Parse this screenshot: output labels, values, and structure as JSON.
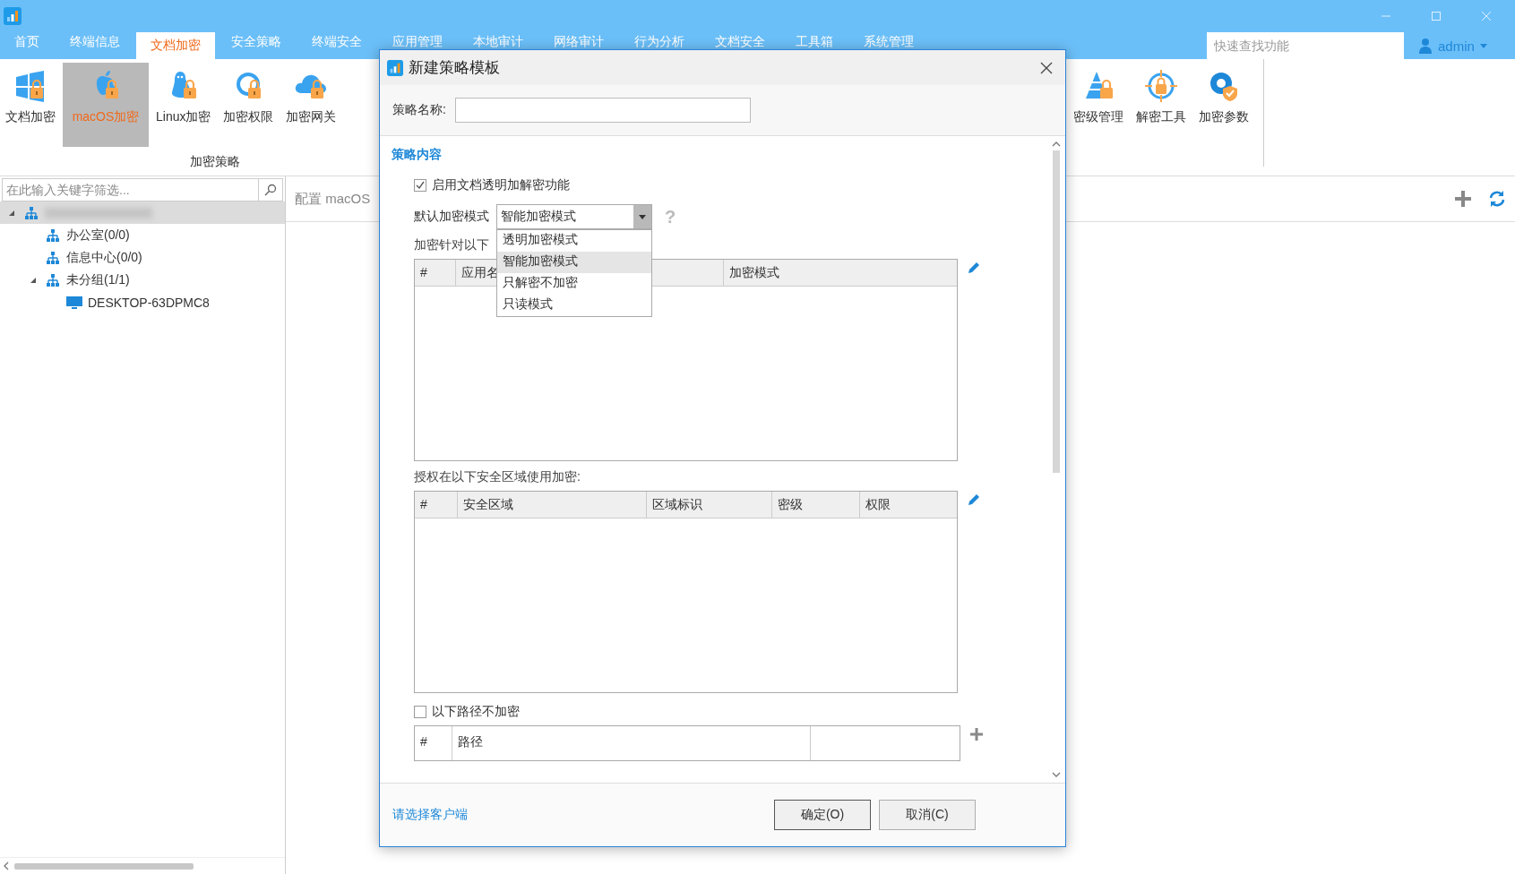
{
  "menu": [
    {
      "label": "首页",
      "selected": false
    },
    {
      "label": "终端信息",
      "selected": false
    },
    {
      "label": "文档加密",
      "selected": true
    },
    {
      "label": "安全策略",
      "selected": false
    },
    {
      "label": "终端安全",
      "selected": false
    },
    {
      "label": "应用管理",
      "selected": false
    },
    {
      "label": "本地审计",
      "selected": false
    },
    {
      "label": "网络审计",
      "selected": false
    },
    {
      "label": "行为分析",
      "selected": false
    },
    {
      "label": "文档安全",
      "selected": false
    },
    {
      "label": "工具箱",
      "selected": false
    },
    {
      "label": "系统管理",
      "selected": false
    }
  ],
  "search": {
    "placeholder": "快速查找功能"
  },
  "user": {
    "name": "admin"
  },
  "ribbon": {
    "group": {
      "label": "加密策略",
      "items": [
        {
          "label": "文档加密",
          "kind": "windows",
          "selected": false
        },
        {
          "label": "macOS加密",
          "kind": "apple",
          "selected": true
        },
        {
          "label": "Linux加密",
          "kind": "linux",
          "selected": false
        },
        {
          "label": "加密权限",
          "kind": "gear",
          "selected": false
        },
        {
          "label": "加密网关",
          "kind": "cloud",
          "selected": false
        }
      ]
    },
    "right_items": [
      {
        "label": "密级管理",
        "kind": "pyramid",
        "selected": false
      },
      {
        "label": "解密工具",
        "kind": "target",
        "selected": false
      },
      {
        "label": "加密参数",
        "kind": "params",
        "selected": false
      }
    ]
  },
  "sidebar": {
    "filter_placeholder": "在此输入关键字筛选...",
    "tree": [
      {
        "kind": "group",
        "expanded": true,
        "selected": true,
        "children": [
          {
            "label": "办公室(0/0)",
            "kind": "group"
          },
          {
            "label": "信息中心(0/0)",
            "kind": "group"
          },
          {
            "label": "未分组(1/1)",
            "kind": "group",
            "expanded": true,
            "children": [
              {
                "label": "DESKTOP-63DPMC8",
                "kind": "computer"
              }
            ]
          }
        ]
      }
    ]
  },
  "main": {
    "header": "配置 macOS"
  },
  "dialog": {
    "title": "新建策略模板",
    "name_label": "策略名称:",
    "section": "策略内容",
    "enable": {
      "label": "启用文档透明加解密功能",
      "checked": true
    },
    "mode": {
      "label": "默认加密模式",
      "value": "智能加密模式",
      "help": "?",
      "expanded": true,
      "options": [
        {
          "label": "透明加密模式",
          "selected": false
        },
        {
          "label": "智能加密模式",
          "selected": true
        },
        {
          "label": "只解密不加密",
          "selected": false
        },
        {
          "label": "只读模式",
          "selected": false
        }
      ]
    },
    "apps": {
      "caption": "加密针对以下",
      "columns": [
        "#",
        "应用名",
        "加密模式"
      ]
    },
    "zones": {
      "caption": "授权在以下安全区域使用加密:",
      "columns": [
        "#",
        "安全区域",
        "区域标识",
        "密级",
        "权限"
      ]
    },
    "exclude": {
      "label": "以下路径不加密",
      "checked": false
    },
    "paths": {
      "columns": [
        "#",
        "路径"
      ]
    },
    "link": "请选择客户端",
    "buttons": [
      "确定(O)",
      "取消(C)"
    ]
  }
}
